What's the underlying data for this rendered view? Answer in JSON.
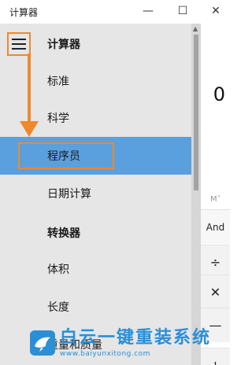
{
  "window": {
    "title": "计算器",
    "minimize_glyph": "—",
    "maximize_glyph": "☐",
    "close_glyph": "✕"
  },
  "nav": {
    "items": [
      {
        "label": "计算器",
        "type": "header"
      },
      {
        "label": "标准",
        "type": "item"
      },
      {
        "label": "科学",
        "type": "item"
      },
      {
        "label": "程序员",
        "type": "item",
        "selected": true
      },
      {
        "label": "日期计算",
        "type": "item"
      },
      {
        "label": "转换器",
        "type": "header"
      },
      {
        "label": "体积",
        "type": "item"
      },
      {
        "label": "长度",
        "type": "item"
      },
      {
        "label": "重量和质量",
        "type": "item"
      }
    ]
  },
  "calculator": {
    "display": "0",
    "memory_label": "M˅",
    "keys": {
      "and": "And",
      "divide": "÷",
      "multiply": "✕",
      "subtract": "—",
      "add": "+"
    }
  },
  "watermark": {
    "text": "白云一键重装系统",
    "url": "www.baiyunxitong.com"
  },
  "colors": {
    "accent_selected": "#5aa0de",
    "annotation_orange": "#f0882c",
    "nav_background": "#e6e6e6",
    "watermark_blue": "#2a8fd6"
  }
}
